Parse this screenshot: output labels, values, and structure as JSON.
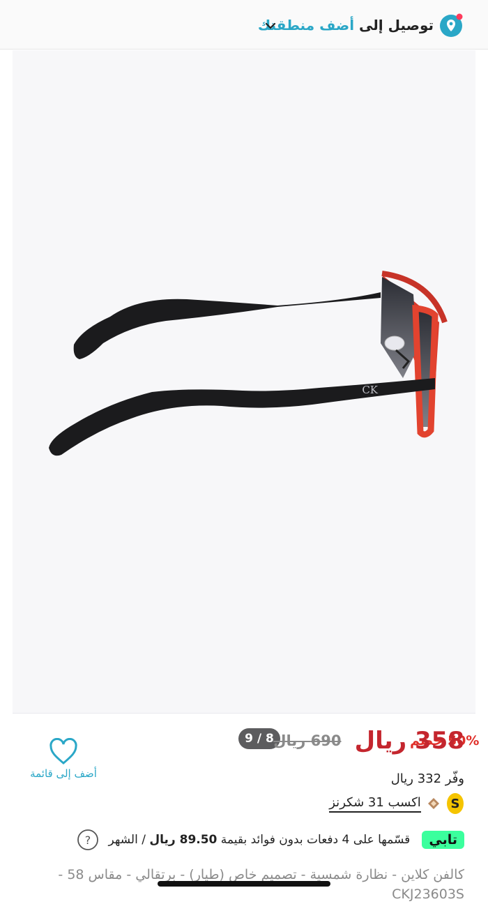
{
  "delivery": {
    "label": "توصيل إلى",
    "action": "أضف منطقتك"
  },
  "gallery": {
    "counter": "9 / 8",
    "discount": "50% خصم"
  },
  "pricing": {
    "current": "358 ريال",
    "old": "690 ريال",
    "savings": "وفّر 332 ريال",
    "cashback": "اكسب 31 شكرنز"
  },
  "wishlist": {
    "label": "أضف إلى قائمة"
  },
  "installments": {
    "logo": "تابي",
    "text_prefix": "قسّمها على 4 دفعات بدون فوائد بقيمة",
    "amount": "89.50 ريال",
    "text_suffix": "/ الشهر"
  },
  "product": {
    "title": "كالفن كلاين - نظارة شمسية - تصميم خاص (طيار) - برتقالي - مقاس 58 - CKJ23603S"
  },
  "colors": {
    "accent": "#2aa7c7",
    "price": "#c4262e",
    "discount": "#e0302a",
    "tabby": "#3bff9d"
  },
  "icons": [
    "location-pin-icon",
    "chevron-down-icon",
    "heart-icon",
    "shukran-icon",
    "diamond-icon",
    "help-icon"
  ]
}
